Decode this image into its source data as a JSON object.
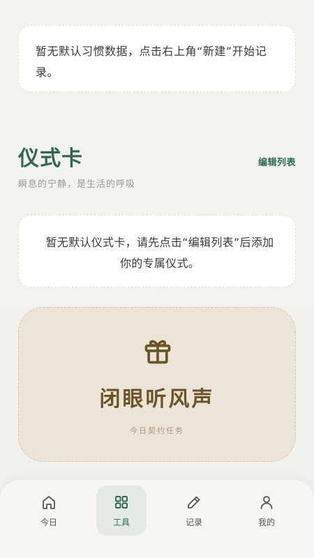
{
  "habits": {
    "empty_message": "暂无默认习惯数据，点击右上角“新建”开始记录。"
  },
  "rituals": {
    "title": "仪式卡",
    "subtitle": "瞬息的宁静，是生活的呼吸",
    "edit_label": "编辑列表",
    "empty_message": "暂无默认仪式卡，请先点击“编辑列表”后添加你的专属仪式。"
  },
  "contract_card": {
    "icon": "gift-icon",
    "name": "闭眼听风声",
    "subtitle": "今日契约任务"
  },
  "tabbar": {
    "active": "tools",
    "accent": "#2e6a4f",
    "items": [
      {
        "id": "today",
        "label": "今日",
        "icon": "home-icon"
      },
      {
        "id": "tools",
        "label": "工具",
        "icon": "grid-icon"
      },
      {
        "id": "records",
        "label": "记录",
        "icon": "pencil-icon"
      },
      {
        "id": "mine",
        "label": "我的",
        "icon": "user-icon"
      }
    ]
  }
}
